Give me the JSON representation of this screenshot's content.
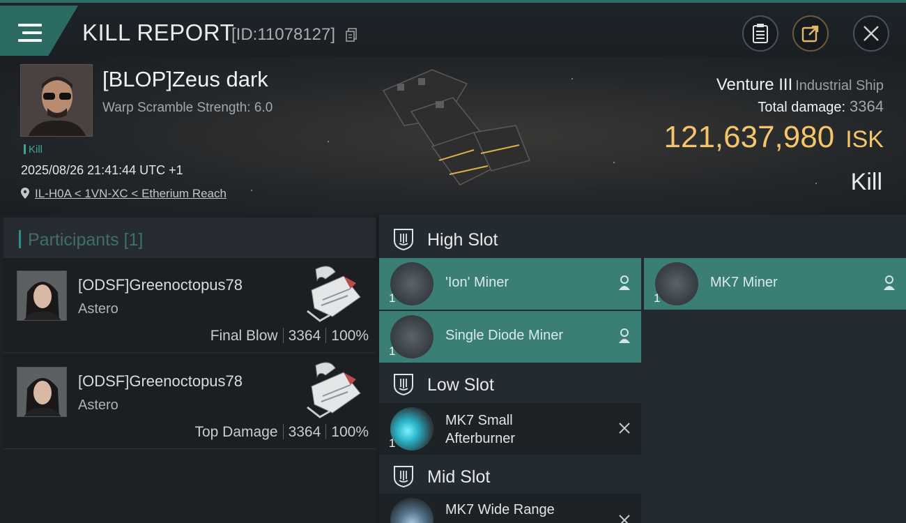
{
  "header": {
    "title": "KILL REPORT",
    "id_text": "[ID:11078127]"
  },
  "victim": {
    "name": "[BLOP]Zeus dark",
    "warp_scramble": "Warp Scramble Strength: 6.0",
    "tag": "Kill",
    "timestamp": "2025/08/26 21:41:44 UTC +1",
    "location": "IL-H0A < 1VN-XC < Etherium Reach"
  },
  "ship": {
    "name": "Venture III",
    "class": "Industrial Ship",
    "total_damage_label": "Total damage:",
    "total_damage_value": "3364",
    "isk_value": "121,637,980",
    "isk_unit": "ISK",
    "result": "Kill"
  },
  "participants": {
    "label": "Participants [1]",
    "rows": [
      {
        "name": "[ODSF]Greenoctopus78",
        "ship": "Astero",
        "role": "Final Blow",
        "damage": "3364",
        "percent": "100%"
      },
      {
        "name": "[ODSF]Greenoctopus78",
        "ship": "Astero",
        "role": "Top Damage",
        "damage": "3364",
        "percent": "100%"
      }
    ]
  },
  "slots": {
    "high": {
      "label": "High Slot",
      "modules": [
        {
          "name": "'Ion' Miner",
          "qty": "1",
          "status": "fitted"
        },
        {
          "name": "MK7 Miner",
          "qty": "1",
          "status": "fitted"
        },
        {
          "name": "Single Diode Miner",
          "qty": "1",
          "status": "fitted"
        }
      ]
    },
    "low": {
      "label": "Low Slot",
      "modules": [
        {
          "name": "MK7 Small Afterburner",
          "qty": "1",
          "status": "destroyed"
        }
      ]
    },
    "mid": {
      "label": "Mid Slot",
      "modules": [
        {
          "name": "MK7 Wide Range",
          "status": "destroyed"
        }
      ]
    }
  },
  "colors": {
    "accent_teal": "#3b7e76",
    "isk_gold": "#f5c56a",
    "background": "#1a1e22"
  }
}
